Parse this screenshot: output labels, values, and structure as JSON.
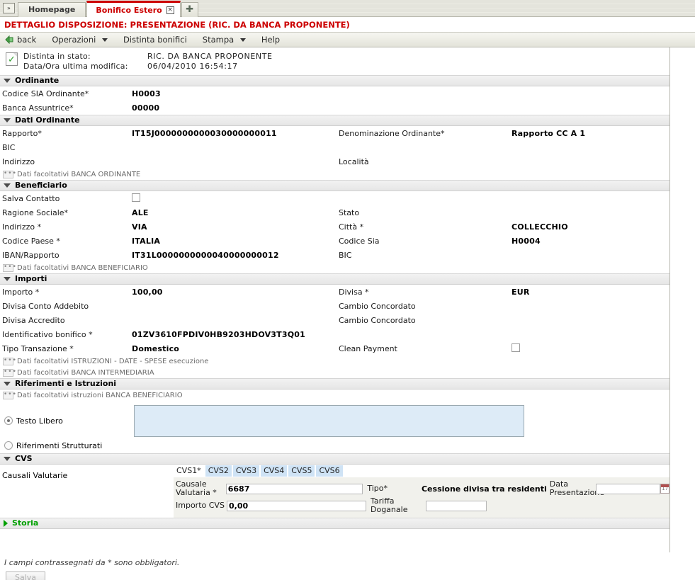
{
  "browser": {
    "tab_menu_label": "»",
    "tabs": [
      {
        "label": "Homepage",
        "active": false
      },
      {
        "label": "Bonifico Estero",
        "active": true
      }
    ],
    "close_icon_label": "✕",
    "new_tab_label": "✚"
  },
  "page": {
    "title": "DETTAGLIO DISPOSIZIONE: PRESENTAZIONE (RIC. DA BANCA PROPONENTE)",
    "accent_color": "#cc0000"
  },
  "menubar": {
    "back_label": "back",
    "items": [
      {
        "label": "Operazioni",
        "has_caret": true
      },
      {
        "label": "Distinta bonifici",
        "has_caret": false
      },
      {
        "label": "Stampa",
        "has_caret": true
      },
      {
        "label": "Help",
        "has_caret": false
      }
    ]
  },
  "status": {
    "stato_label": "Distinta in stato:",
    "stato_value": "RIC. DA BANCA PROPONENTE",
    "modifica_label": "Data/Ora ultima modifica:",
    "modifica_value": "06/04/2010 16:54:17"
  },
  "sections": {
    "ordinante": {
      "title": "Ordinante",
      "rows": [
        {
          "label": "Codice SIA Ordinante*",
          "value": "H0003"
        },
        {
          "label": "Banca Assuntrice*",
          "value": "00000"
        }
      ]
    },
    "dati_ordinante": {
      "title": "Dati Ordinante",
      "rows": [
        {
          "l1": "Rapporto*",
          "v1": "IT15J0000000000030000000011",
          "l2": "Denominazione Ordinante*",
          "v2": "Rapporto CC A 1"
        },
        {
          "l1": "BIC",
          "v1": "",
          "l2": "",
          "v2": ""
        },
        {
          "l1": "Indirizzo",
          "v1": "",
          "l2": "Località",
          "v2": ""
        }
      ],
      "optional_link": "Dati facoltativi BANCA ORDINANTE"
    },
    "beneficiario": {
      "title": "Beneficiario",
      "salva_contatto_label": "Salva Contatto",
      "salva_contatto_checked": false,
      "rows": [
        {
          "l1": "Ragione Sociale*",
          "v1": "ALE",
          "l2": "Stato",
          "v2": ""
        },
        {
          "l1": "Indirizzo *",
          "v1": "VIA",
          "l2": "Città *",
          "v2": "COLLECCHIO"
        },
        {
          "l1": "Codice Paese *",
          "v1": "ITALIA",
          "l2": "Codice Sia",
          "v2": "H0004"
        },
        {
          "l1": "IBAN/Rapporto",
          "v1": "IT31L0000000000040000000012",
          "l2": "BIC",
          "v2": ""
        }
      ],
      "optional_link": "Dati facoltativi BANCA BENEFICIARIO"
    },
    "importi": {
      "title": "Importi",
      "rows": [
        {
          "l1": "Importo *",
          "v1": "100,00",
          "l2": "Divisa *",
          "v2": "EUR"
        },
        {
          "l1": "Divisa Conto Addebito",
          "v1": "",
          "l2": "Cambio Concordato",
          "v2": ""
        },
        {
          "l1": "Divisa Accredito",
          "v1": "",
          "l2": "Cambio Concordato",
          "v2": ""
        },
        {
          "l1": "Identificativo bonifico *",
          "v1": "01ZV3610FPDIV0HB9203HDOV3T3Q01",
          "l2": "",
          "v2": ""
        }
      ],
      "tipo_transazione_label": "Tipo Transazione *",
      "tipo_transazione_value": "Domestico",
      "clean_payment_label": "Clean Payment",
      "clean_payment_checked": false,
      "optional_links": [
        "Dati facoltativi ISTRUZIONI - DATE - SPESE esecuzione",
        "Dati facoltativi BANCA INTERMEDIARIA"
      ]
    },
    "riferimenti": {
      "title": "Riferimenti e Istruzioni",
      "optional_link": "Dati facoltativi istruzioni BANCA BENEFICIARIO",
      "testo_libero_label": "Testo Libero",
      "testo_libero_selected": true,
      "testo_libero_value": "",
      "riferimenti_strutturati_label": "Riferimenti Strutturati",
      "riferimenti_strutturati_selected": false
    },
    "cvs": {
      "title": "CVS",
      "causali_label": "Causali Valutarie",
      "tabs": [
        {
          "label": "CVS1*",
          "active": true
        },
        {
          "label": "CVS2",
          "active": false
        },
        {
          "label": "CVS3",
          "active": false
        },
        {
          "label": "CVS4",
          "active": false
        },
        {
          "label": "CVS5",
          "active": false
        },
        {
          "label": "CVS6",
          "active": false
        }
      ],
      "causale_valutaria_label": "Causale Valutaria *",
      "causale_valutaria_value": "6687",
      "tipo_label": "Tipo*",
      "tipo_value": "Cessione divisa tra residenti",
      "data_presentazione_label": "Data Presentazione",
      "data_presentazione_value": "",
      "calendar_icon_label": "17",
      "importo_cvs_label": "Importo CVS",
      "importo_cvs_value": "0,00",
      "tariffa_doganale_label": "Tariffa Doganale",
      "tariffa_doganale_value": ""
    },
    "storia": {
      "title": "Storia"
    }
  },
  "footer": {
    "note": "I campi contrassegnati da * sono obbligatori.",
    "save_label": "Salva"
  }
}
